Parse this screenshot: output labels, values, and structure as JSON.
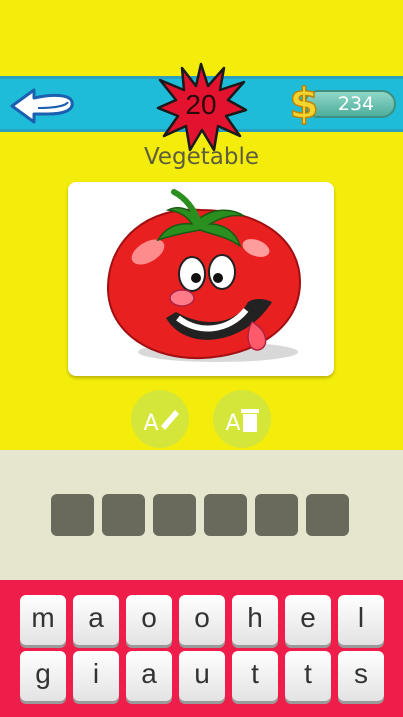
{
  "header": {
    "level": "20",
    "coins": "234",
    "back_icon": "back-arrow-icon",
    "coin_icon": "dollar-icon",
    "colors": {
      "band": "#1fbcd9",
      "star": "#e3122f",
      "background": "#f4ec0a"
    }
  },
  "puzzle": {
    "category": "Vegetable",
    "image_subject": "tomato-image",
    "answer_slots": 6
  },
  "hints": [
    {
      "icon": "reveal-letter-icon"
    },
    {
      "icon": "remove-letters-icon"
    }
  ],
  "keyboard": {
    "row1": [
      "m",
      "a",
      "o",
      "o",
      "h",
      "e",
      "l"
    ],
    "row2": [
      "g",
      "i",
      "a",
      "u",
      "t",
      "t",
      "s"
    ],
    "color": "#ee1d4a"
  }
}
